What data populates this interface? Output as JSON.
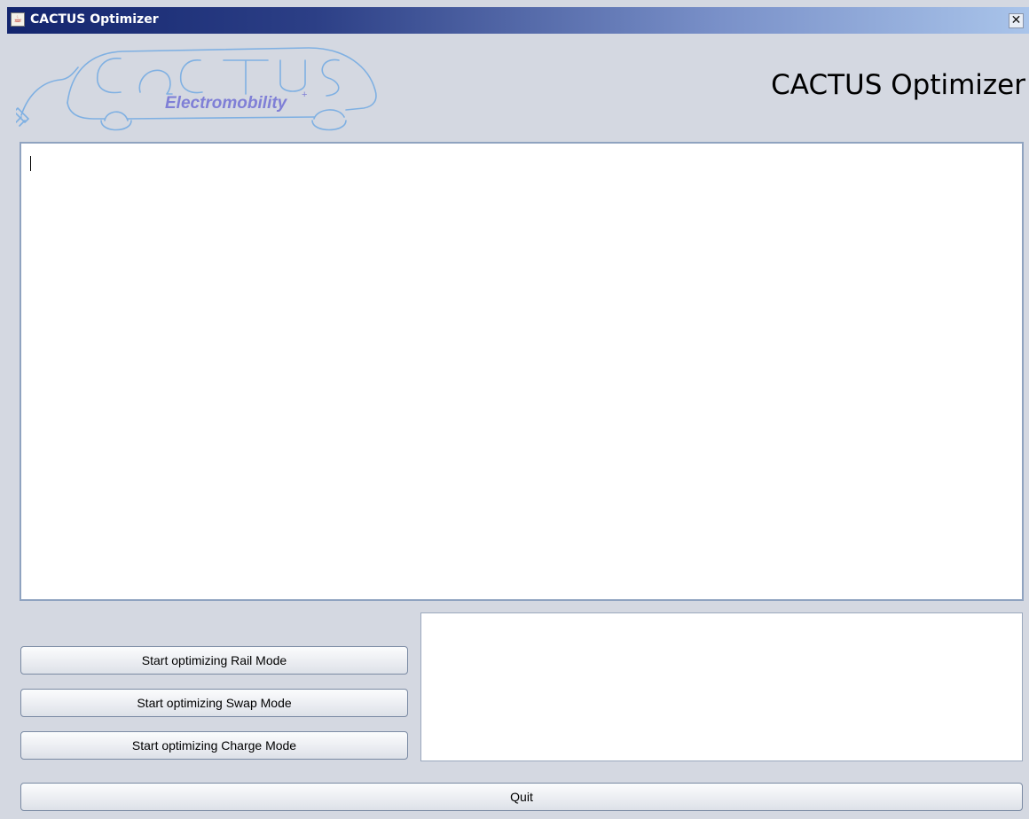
{
  "window": {
    "title": "CACTUS Optimizer",
    "close_glyph": "✕"
  },
  "logo": {
    "letters": "CACTUS",
    "tagline": "Electromobility",
    "tagline_mark": "+"
  },
  "header": {
    "title": "CACTUS Optimizer"
  },
  "main_text": {
    "value": ""
  },
  "side_text": {
    "value": ""
  },
  "buttons": {
    "rail": "Start optimizing Rail Mode",
    "swap": "Start optimizing Swap Mode",
    "charge": "Start optimizing Charge Mode",
    "quit": "Quit"
  },
  "colors": {
    "window_bg": "#d4d8e1",
    "titlebar_start": "#13256e",
    "titlebar_end": "#a9c4ea",
    "logo_stroke": "#7fb0e2",
    "logo_text": "#7f7fd6"
  },
  "icons": {
    "title": "java-cup-icon",
    "close": "close-icon"
  }
}
